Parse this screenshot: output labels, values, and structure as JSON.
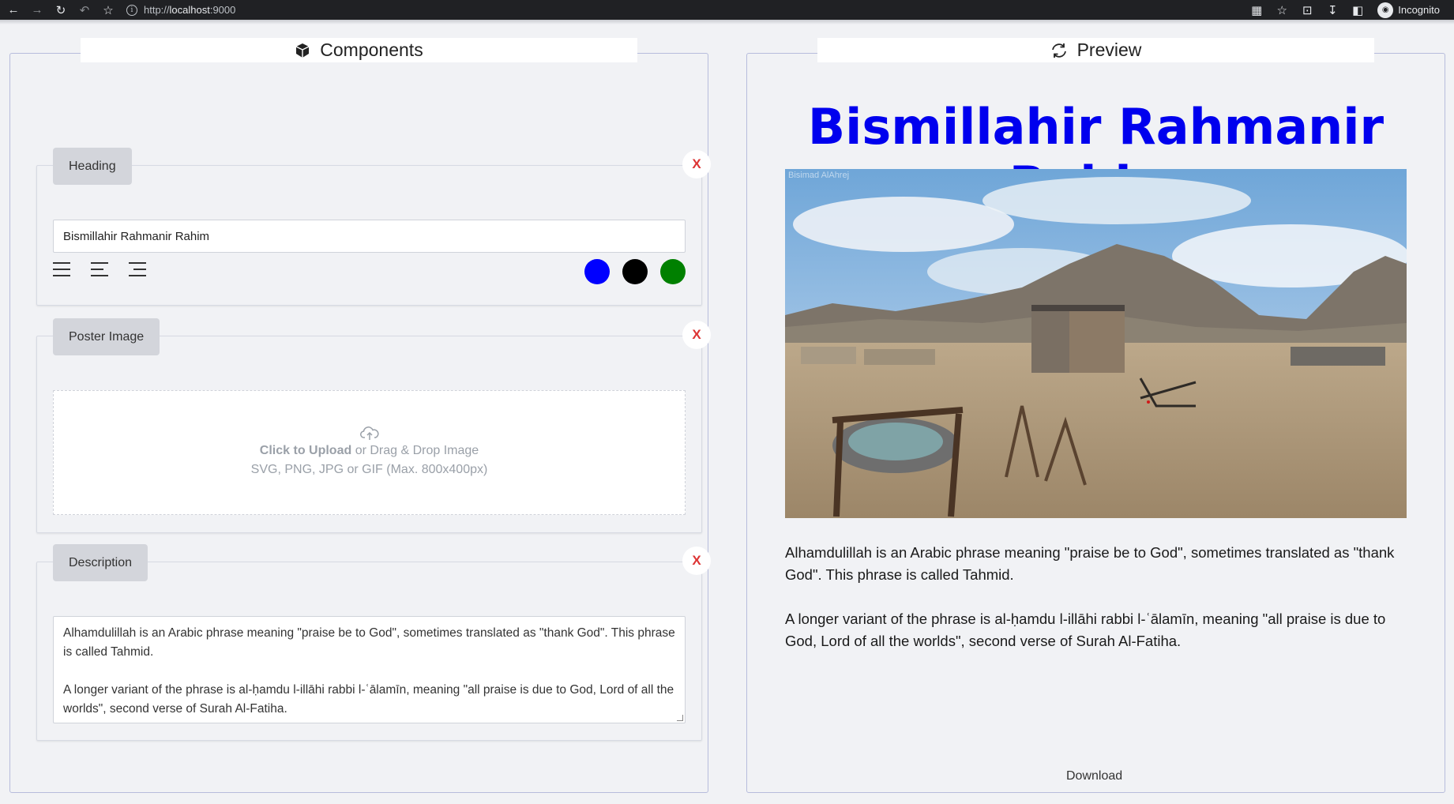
{
  "browser": {
    "url_scheme": "http://",
    "url_host": "localhost",
    "url_port": ":9000",
    "profile_label": "Incognito"
  },
  "components_panel": {
    "title": "Components",
    "heading_card": {
      "tag": "Heading",
      "remove_label": "X",
      "value": "Bismillahir Rahmanir Rahim",
      "color_options": [
        "#0000ff",
        "#000000",
        "#008000"
      ]
    },
    "poster_card": {
      "tag": "Poster Image",
      "remove_label": "X",
      "upload_strong": "Click to Upload",
      "upload_rest": " or Drag & Drop Image",
      "upload_hint": "SVG, PNG, JPG or GIF (Max. 800x400px)"
    },
    "description_card": {
      "tag": "Description",
      "remove_label": "X",
      "paragraph1": "Alhamdulillah is an Arabic phrase meaning \"praise be to God\", sometimes translated as \"thank God\". This phrase is called Tahmid.",
      "paragraph2": "A longer variant of the phrase is al-ḥamdu l-illāhi rabbi l-ʿālamīn, meaning \"all praise is due to God, Lord of all the worlds\", second verse of Surah Al-Fatiha."
    }
  },
  "preview_panel": {
    "title": "Preview",
    "heading": "Bismillahir Rahmanir Rahim",
    "heading_color": "#0000ee",
    "image_watermark": "Bisimad AlAhrej",
    "paragraph1": "Alhamdulillah is an Arabic phrase meaning \"praise be to God\", sometimes translated as \"thank God\". This phrase is called Tahmid.",
    "paragraph2": "A longer variant of the phrase is al-ḥamdu l-illāhi rabbi l-ʿālamīn, meaning \"all praise is due to God, Lord of all the worlds\", second verse of Surah Al-Fatiha.",
    "download_label": "Download"
  }
}
